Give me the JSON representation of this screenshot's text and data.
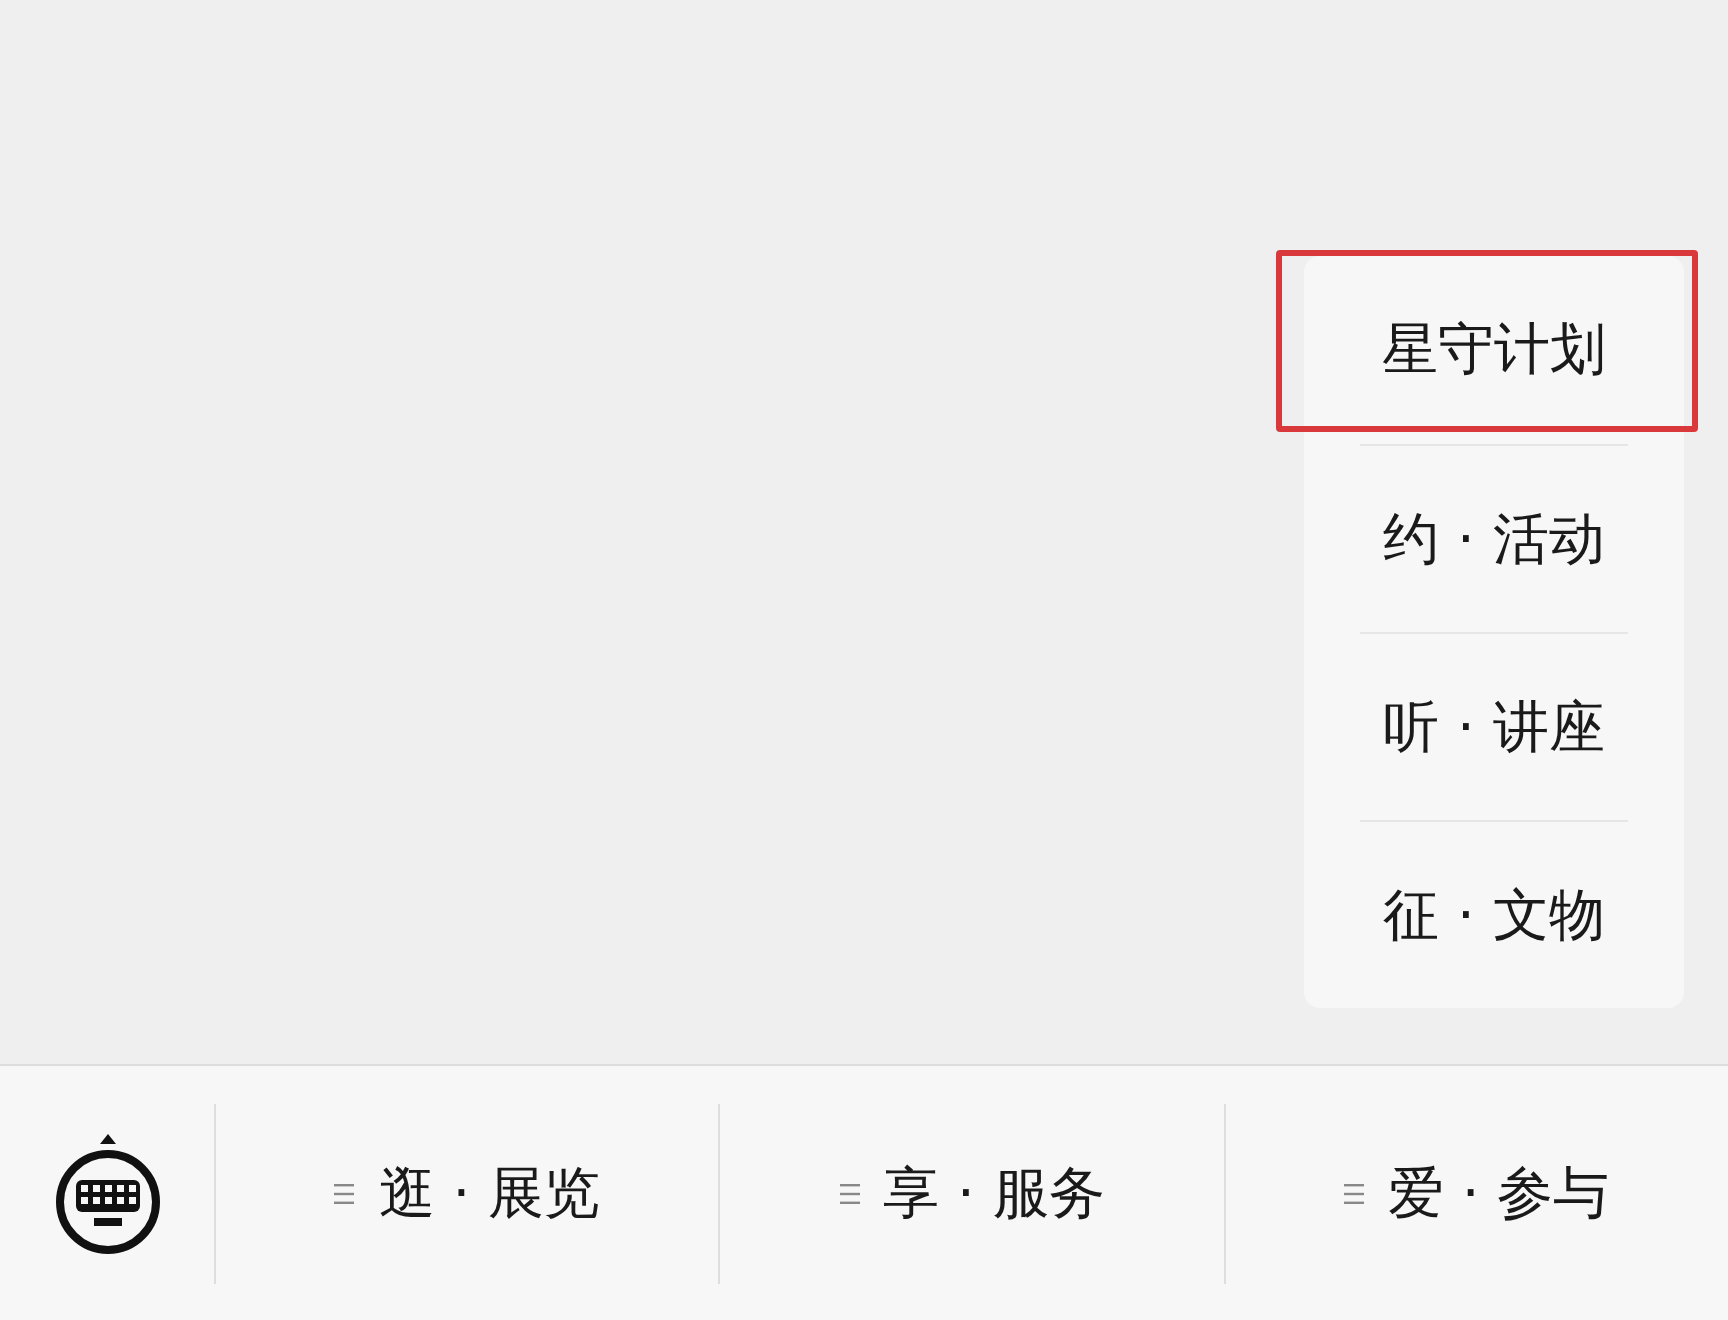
{
  "menus": [
    {
      "label": "逛 · 展览"
    },
    {
      "label": "享 · 服务"
    },
    {
      "label": "爱 · 参与",
      "items": [
        {
          "label": "星守计划",
          "highlighted": true
        },
        {
          "label": "约 · 活动",
          "highlighted": false
        },
        {
          "label": "听 · 讲座",
          "highlighted": false
        },
        {
          "label": "征 · 文物",
          "highlighted": false
        }
      ]
    }
  ]
}
